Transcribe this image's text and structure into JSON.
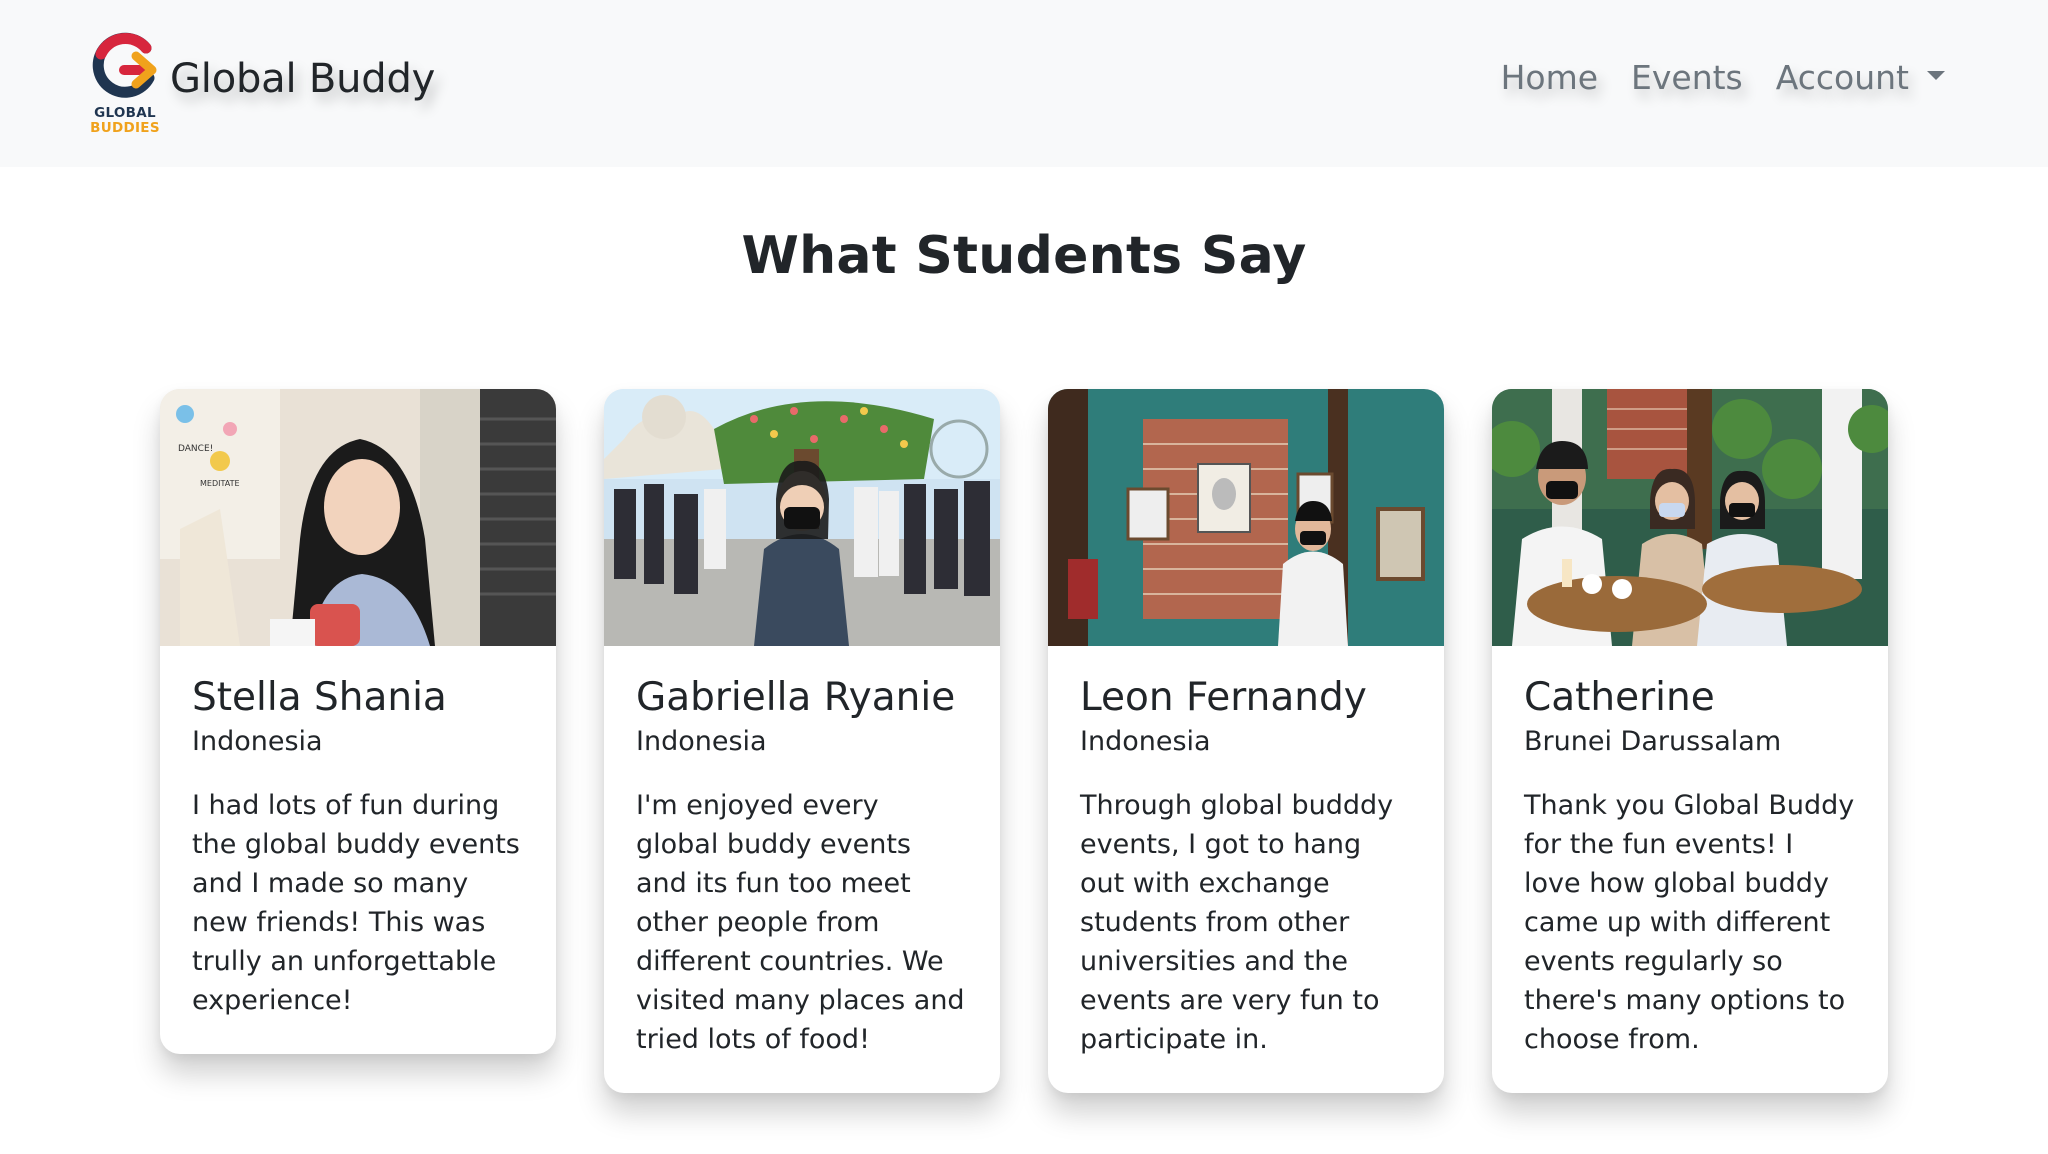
{
  "brand": {
    "name": "Global Buddy",
    "logo_line1": "GLOBAL",
    "logo_line2": "BUDDIES",
    "logo_icon": "global-buddies-logo"
  },
  "nav": {
    "items": [
      {
        "label": "Home"
      },
      {
        "label": "Events"
      },
      {
        "label": "Account"
      }
    ]
  },
  "section": {
    "title": "What Students Say"
  },
  "testimonials": [
    {
      "name": "Stella Shania",
      "country": "Indonesia",
      "quote": "I had lots of fun during the global buddy events and I made so many new friends! This was trully an unforgettable experience!"
    },
    {
      "name": "Gabriella Ryanie",
      "country": "Indonesia",
      "quote": "I'm enjoyed every global buddy events and its fun too meet other people from different countries. We visited many places and tried lots of food!"
    },
    {
      "name": "Leon Fernandy",
      "country": "Indonesia",
      "quote": "Through global budddy events, I got to hang out with exchange students from other universities and the events are very fun to participate in."
    },
    {
      "name": "Catherine",
      "country": "Brunei Darussalam",
      "quote": "Thank you Global Buddy for the fun events! I love how global buddy came up with different events regularly so there's many options to choose from."
    }
  ],
  "colors": {
    "navbar_bg": "#f8f9fa",
    "logo_red": "#d7263d",
    "logo_navy": "#1f3550",
    "logo_yellow": "#f0a21c",
    "text": "#212529",
    "nav_text": "#6c757d"
  }
}
